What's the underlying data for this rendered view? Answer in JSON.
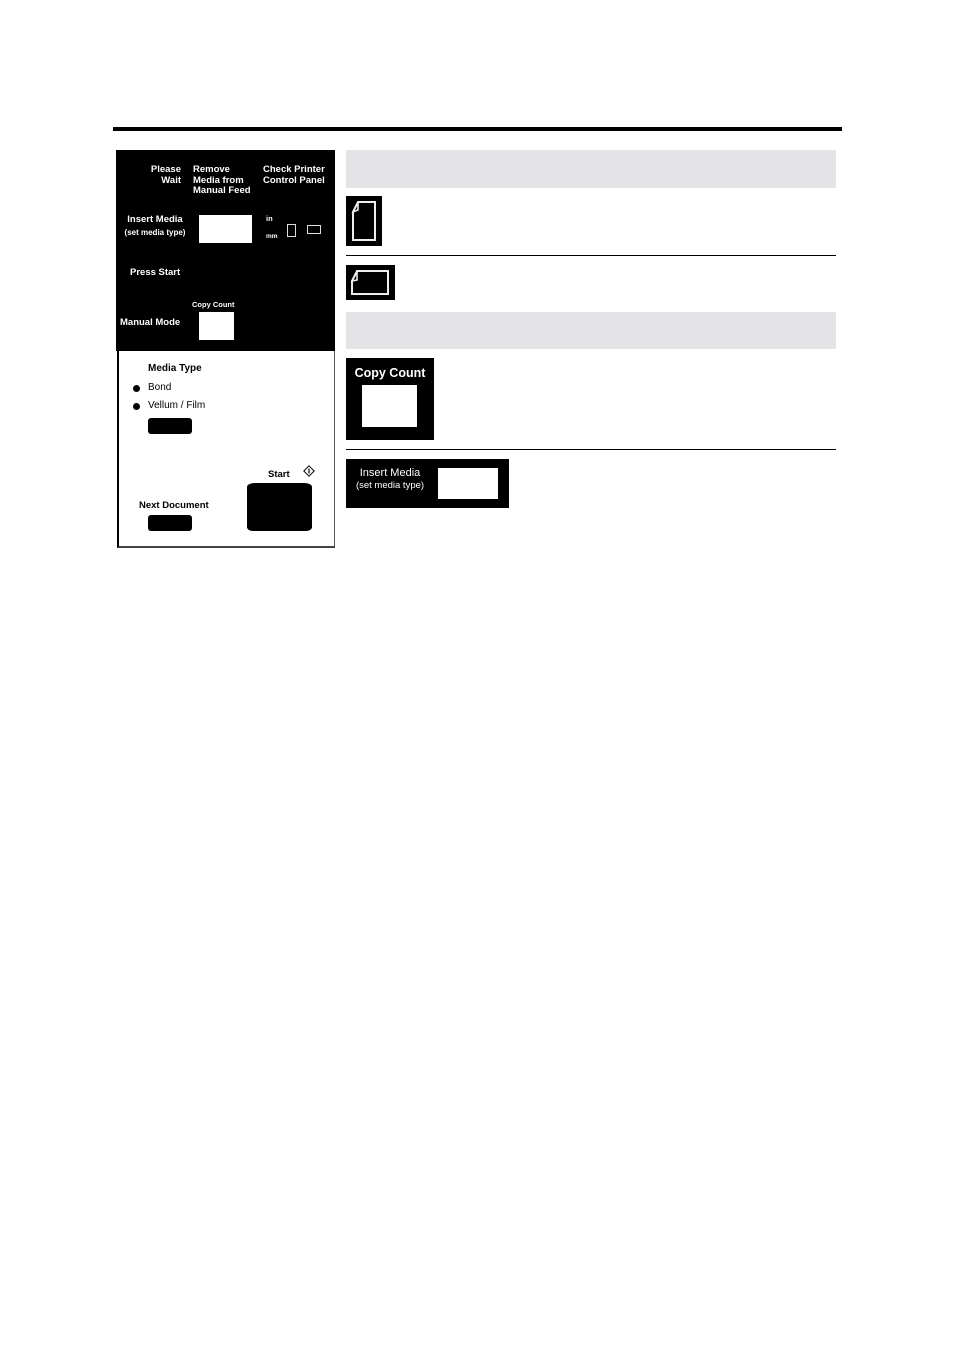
{
  "panel": {
    "status_labels": {
      "please_wait": [
        "Please",
        "Wait"
      ],
      "remove_media": [
        "Remove",
        "Media from",
        "Manual Feed"
      ],
      "check_printer": [
        "Check Printer",
        "Control Panel"
      ]
    },
    "insert_media": [
      "Insert Media",
      "(set media type)"
    ],
    "unit_in": "in",
    "unit_mm": "mm",
    "press_start": "Press Start",
    "copy_count": "Copy Count",
    "manual_mode": "Manual Mode",
    "media_type_title": "Media Type",
    "media_options": [
      "Bond",
      "Vellum / Film"
    ],
    "start_label": "Start",
    "next_document_label": "Next Document"
  },
  "legend": {
    "copy_count_label": "Copy Count",
    "insert_media_label": [
      "Insert Media",
      "(set media type)"
    ]
  }
}
